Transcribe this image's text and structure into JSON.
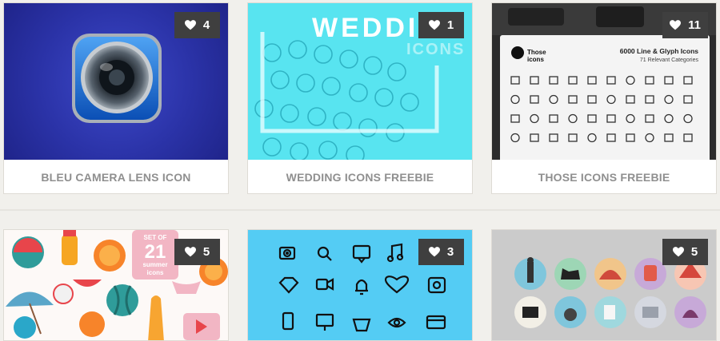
{
  "cards": [
    {
      "title": "BLEU CAMERA LENS ICON",
      "likes": "4"
    },
    {
      "title": "WEDDING ICONS FREEBIE",
      "likes": "1",
      "thumb_text": {
        "headline": "WEDDI",
        "sub": "ICONS"
      }
    },
    {
      "title": "THOSE ICONS FREEBIE",
      "likes": "11",
      "thumb_text": {
        "brand_line1": "Those",
        "brand_line2": "icons",
        "headline": "6000 Line & Glyph Icons",
        "sub": "71 Relevant Categories"
      }
    },
    {
      "title": "",
      "likes": "5",
      "thumb_text": {
        "badge_top": "SET OF",
        "badge_number": "21",
        "badge_line1": "summer",
        "badge_line2": "icons"
      }
    },
    {
      "title": "",
      "likes": "3"
    },
    {
      "title": "",
      "likes": "5"
    }
  ],
  "colors": {
    "page_bg": "#f1f0ec",
    "badge_bg": "#3f3f3f",
    "caption_text": "#8f8f8f",
    "camera_bg": "#2b33a8",
    "wedding_bg": "#58e4f0",
    "icons_blue_bg": "#54ccf4"
  },
  "icons": [
    "heart-icon"
  ]
}
